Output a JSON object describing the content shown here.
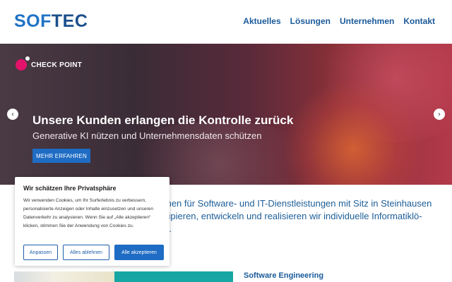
{
  "header": {
    "logo_part1": "SOF",
    "logo_part2": "TEC",
    "nav": [
      "Aktuelles",
      "Lösungen",
      "Unternehmen",
      "Kontakt"
    ]
  },
  "hero": {
    "brand": "CHECK POINT",
    "title": "Unsere Kunden erlangen die Kontrolle zurück",
    "subtitle": "Generative KI nützen und Unternehmensdaten schützen",
    "cta": "MEHR ERFAHREN",
    "prev_arrow": "‹",
    "next_arrow": "›"
  },
  "intro": {
    "line1": "men für Software- und IT-Dienstleistungen mit Sitz in Steinhausen",
    "line2": "zipieren, entwickeln und realisieren wir individuelle Informatiklö-",
    "line3": "n."
  },
  "section": {
    "title": "Software Engineering"
  },
  "cookie": {
    "title": "Wir schätzen Ihre Privatsphäre",
    "text": "Wir verwenden Cookies, um Ihr Surferlebnis zu verbessern, personalisierte Anzeigen oder Inhalte einzusetzen und unseren Datenverkehr zu analysieren. Wenn Sie auf „Alle akzeptieren“ klicken, stimmen Sie der Anwendung von Cookies zu.",
    "btn_customize": "Anpassen",
    "btn_reject": "Alles ablehnen",
    "btn_accept": "Alle akzeptieren"
  }
}
